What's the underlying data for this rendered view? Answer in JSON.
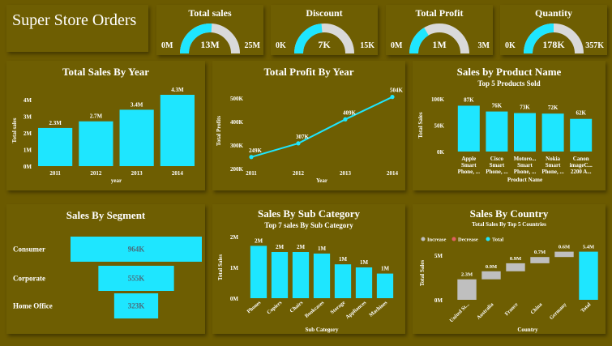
{
  "header": {
    "title": "Super Store Orders"
  },
  "colors": {
    "background": "#6b5a00",
    "card": "#6e5e02",
    "accent": "#1ee6ff",
    "track": "#d9d9d9",
    "increase": "#bfbfbf",
    "decrease": "#e06060"
  },
  "kpis": [
    {
      "title": "Total sales",
      "value": "13M",
      "min": "0M",
      "max": "25M",
      "fraction": 0.52
    },
    {
      "title": "Discount",
      "value": "7K",
      "min": "0K",
      "max": "15K",
      "fraction": 0.47
    },
    {
      "title": "Total Profit",
      "value": "1M",
      "min": "0M",
      "max": "3M",
      "fraction": 0.33
    },
    {
      "title": "Quantity",
      "value": "178K",
      "min": "0K",
      "max": "357K",
      "fraction": 0.5
    }
  ],
  "chart_data": [
    {
      "id": "sales_by_year",
      "type": "bar",
      "title": "Total Sales By Year",
      "xlabel": "year",
      "ylabel": "Total sales",
      "categories": [
        "2011",
        "2012",
        "2013",
        "2014"
      ],
      "values": [
        2.3,
        2.7,
        3.4,
        4.3
      ],
      "data_labels": [
        "2.3M",
        "2.7M",
        "3.4M",
        "4.3M"
      ],
      "ylim": [
        0,
        4.3
      ],
      "yticks": [
        0,
        1,
        2,
        3,
        4
      ],
      "ytick_labels": [
        "0M",
        "1M",
        "2M",
        "3M",
        "4M"
      ]
    },
    {
      "id": "profit_by_year",
      "type": "line",
      "title": "Total Profit By Year",
      "xlabel": "Year",
      "ylabel": "Total Profits",
      "categories": [
        "2011",
        "2012",
        "2013",
        "2014"
      ],
      "values": [
        249,
        307,
        409,
        504
      ],
      "data_labels": [
        "249K",
        "307K",
        "409K",
        "504K"
      ],
      "ylim": [
        200,
        520
      ],
      "yticks": [
        200,
        300,
        400,
        500
      ],
      "ytick_labels": [
        "200K",
        "300K",
        "400K",
        "500K"
      ]
    },
    {
      "id": "sales_by_product",
      "type": "bar",
      "title": "Sales by Product Name",
      "subtitle": "Top 5 Products Sold",
      "xlabel": "Product Name",
      "ylabel": "Total Sales",
      "categories": [
        [
          "Apple",
          "Smart",
          "Phone, ..."
        ],
        [
          "Cisco",
          "Smart",
          "Phone, ..."
        ],
        [
          "Motoro...",
          "Smart",
          "Phone, ..."
        ],
        [
          "Nokia",
          "Smart",
          "Phone, ..."
        ],
        [
          "Canon",
          "imageC...",
          "2200 A..."
        ]
      ],
      "values": [
        87,
        76,
        73,
        72,
        62
      ],
      "data_labels": [
        "87K",
        "76K",
        "73K",
        "72K",
        "62K"
      ],
      "ylim": [
        0,
        100
      ],
      "yticks": [
        0,
        50,
        100
      ],
      "ytick_labels": [
        "0K",
        "50K",
        "100K"
      ]
    },
    {
      "id": "sales_by_segment",
      "type": "bar",
      "title": "Sales By Segment",
      "categories": [
        "Consumer",
        "Corporate",
        "Home Office"
      ],
      "values": [
        964,
        555,
        323
      ],
      "data_labels": [
        "964K",
        "555K",
        "323K"
      ]
    },
    {
      "id": "sales_by_subcategory",
      "type": "bar",
      "title": "Sales By Sub Category",
      "subtitle": "Top 7 sales By Sub Category",
      "xlabel": "Sub Category",
      "ylabel": "Total Sales",
      "categories": [
        "Phones",
        "Copiers",
        "Chairs",
        "Bookcases",
        "Storage",
        "Appliances",
        "Machines"
      ],
      "values": [
        1.7,
        1.5,
        1.5,
        1.45,
        1.1,
        1.0,
        0.8
      ],
      "data_labels": [
        "2M",
        "2M",
        "2M",
        "1M",
        "1M",
        "1M",
        "1M"
      ],
      "ylim": [
        0,
        2
      ],
      "yticks": [
        0,
        1,
        2
      ],
      "ytick_labels": [
        "0M",
        "1M",
        "2M"
      ]
    },
    {
      "id": "sales_by_country",
      "type": "bar",
      "title": "Sales By Country",
      "subtitle": "Total Sales By Top 5 Countries",
      "xlabel": "Country",
      "ylabel": "Total Sales",
      "legend": [
        "Increase",
        "Decrease",
        "Total"
      ],
      "categories": [
        "United St...",
        "Australia",
        "France",
        "China",
        "Germany",
        "Total"
      ],
      "values": [
        2.3,
        0.9,
        0.9,
        0.7,
        0.6,
        5.4
      ],
      "kinds": [
        "increase",
        "increase",
        "increase",
        "increase",
        "increase",
        "total"
      ],
      "data_labels": [
        "2.3M",
        "0.9M",
        "0.9M",
        "0.7M",
        "0.6M",
        "5.4M"
      ],
      "ylim": [
        0,
        6
      ],
      "yticks": [
        0,
        5
      ],
      "ytick_labels": [
        "0M",
        "5M"
      ]
    }
  ]
}
